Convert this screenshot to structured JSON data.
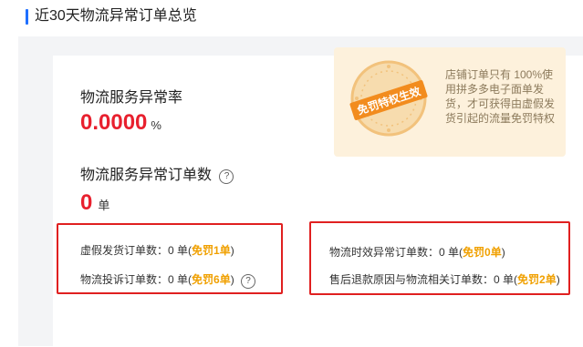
{
  "section": {
    "title": "近30天物流异常订单总览"
  },
  "rate": {
    "label": "物流服务异常率",
    "value": "0.0000",
    "unit": "%"
  },
  "count": {
    "label": "物流服务异常订单数",
    "help": "?",
    "value": "0",
    "unit": "单"
  },
  "left_stats": [
    {
      "label": "虚假发货订单数：",
      "value": "0 单",
      "free": "免罚1单"
    },
    {
      "label": "物流投诉订单数：",
      "value": "0 单",
      "free": "免罚6单"
    }
  ],
  "left_help": "?",
  "right_stats": [
    {
      "label": "物流时效异常订单数：",
      "value": "0 单",
      "free": "免罚0单"
    },
    {
      "label": "售后退款原因与物流相关订单数：",
      "value": "0 单",
      "free": "免罚2单"
    }
  ],
  "promo": {
    "seal_text": "免罚特权生效",
    "description": "店铺订单只有 100%使用拼多多电子面单发货，才可获得由虚假发货引起的流量免罚特权"
  },
  "colors": {
    "accent": "#1f6fff",
    "danger": "#e8202e",
    "orange": "#f0a000",
    "promo_bg": "#fdf1dc"
  },
  "icons": [
    "help-icon",
    "seal-stamp"
  ]
}
